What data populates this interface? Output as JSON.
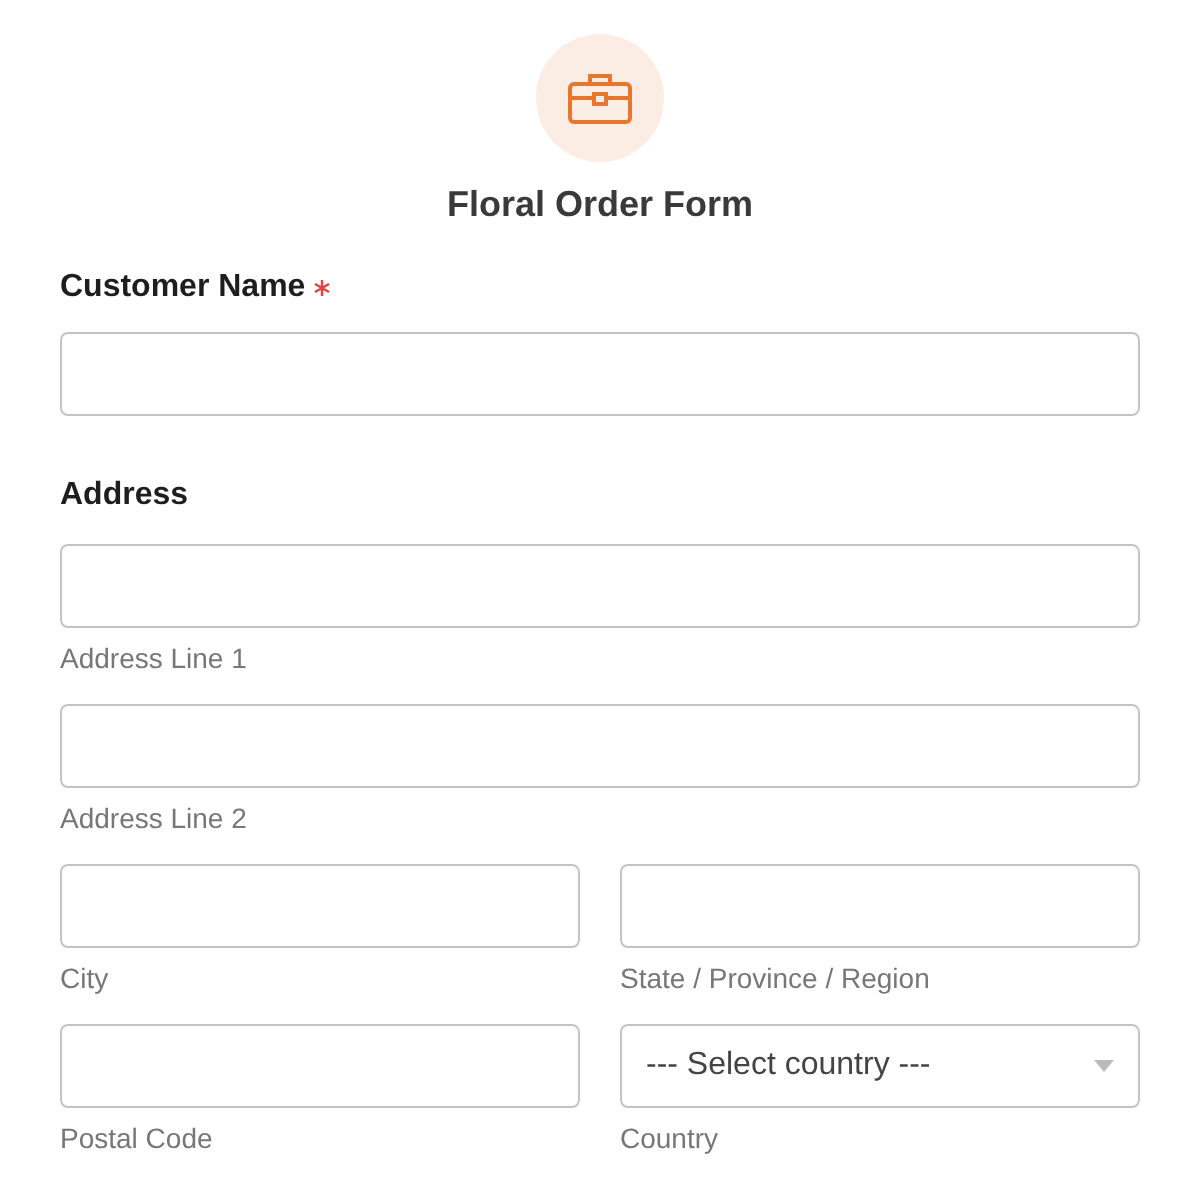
{
  "form": {
    "title": "Floral Order Form"
  },
  "customer_name": {
    "label": "Customer Name",
    "required": true
  },
  "address": {
    "heading": "Address",
    "rows": [
      {
        "fields": [
          {
            "kind": "input",
            "sublabel": "Address Line 1"
          }
        ]
      },
      {
        "fields": [
          {
            "kind": "input",
            "sublabel": "Address Line 2"
          }
        ]
      },
      {
        "fields": [
          {
            "kind": "input",
            "sublabel": "City"
          },
          {
            "kind": "input",
            "sublabel": "State / Province / Region"
          }
        ]
      },
      {
        "fields": [
          {
            "kind": "input",
            "sublabel": "Postal Code"
          },
          {
            "kind": "select",
            "value": "--- Select country ---",
            "sublabel": "Country"
          }
        ]
      }
    ]
  }
}
